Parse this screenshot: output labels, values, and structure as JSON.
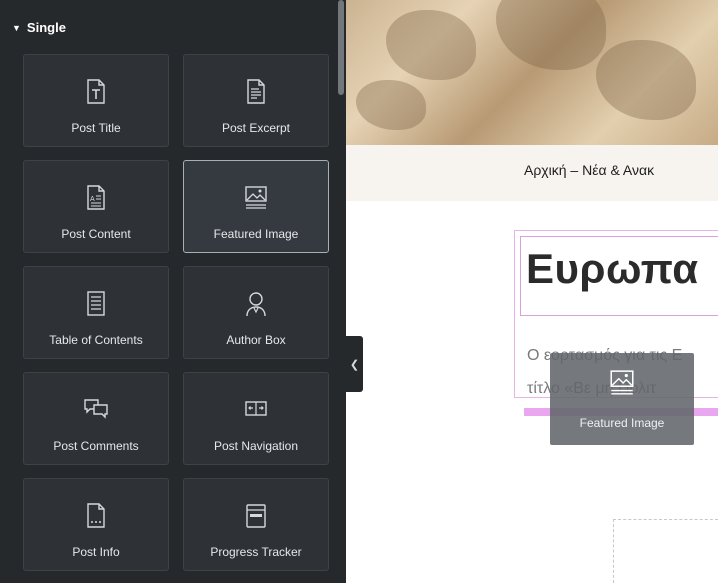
{
  "panel": {
    "section_title": "Single",
    "widgets": [
      {
        "label": "Post Title",
        "icon": "post-title-icon"
      },
      {
        "label": "Post Excerpt",
        "icon": "post-excerpt-icon"
      },
      {
        "label": "Post Content",
        "icon": "post-content-icon"
      },
      {
        "label": "Featured Image",
        "icon": "featured-image-icon"
      },
      {
        "label": "Table of Contents",
        "icon": "table-of-contents-icon"
      },
      {
        "label": "Author Box",
        "icon": "author-box-icon"
      },
      {
        "label": "Post Comments",
        "icon": "post-comments-icon"
      },
      {
        "label": "Post Navigation",
        "icon": "post-navigation-icon"
      },
      {
        "label": "Post Info",
        "icon": "post-info-icon"
      },
      {
        "label": "Progress Tracker",
        "icon": "progress-tracker-icon"
      }
    ]
  },
  "preview": {
    "breadcrumb": "Αρχική – Νέα & Ανακ",
    "title": "Ευρωπα",
    "excerpt_line1": "Ο εορτασμός για τις Ε",
    "excerpt_line2": "τίτλο «Βε  μη Πολιτ"
  },
  "drag_ghost": {
    "label": "Featured Image",
    "icon": "featured-image-icon"
  },
  "colors": {
    "panel_bg": "#26292c",
    "tile_bg": "#2e3136",
    "drop_indicator": "#e8a7ee",
    "selection_outline": "#e8b3e8"
  }
}
